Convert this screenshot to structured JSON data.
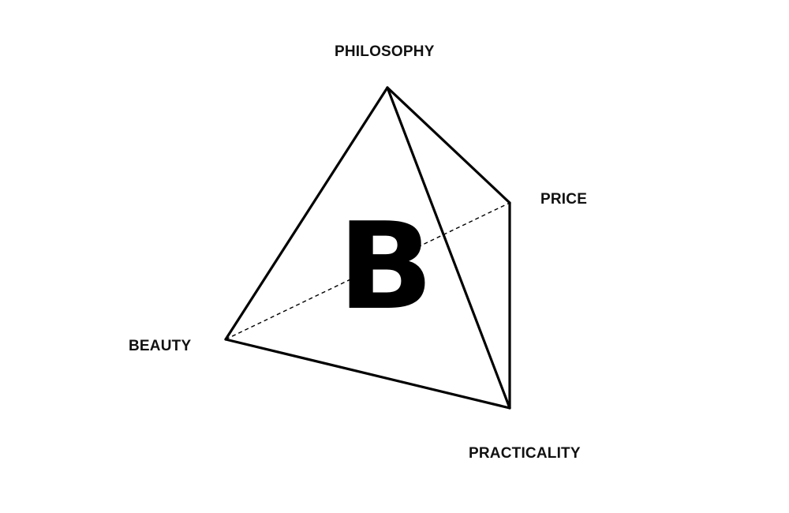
{
  "diagram": {
    "center_letter": "B",
    "vertices": {
      "top": "PHILOSOPHY",
      "right": "PRICE",
      "left": "BEAUTY",
      "bottom": "PRACTICALITY"
    },
    "colors": {
      "stroke": "#000000",
      "text": "#111111",
      "background": "#ffffff"
    }
  }
}
